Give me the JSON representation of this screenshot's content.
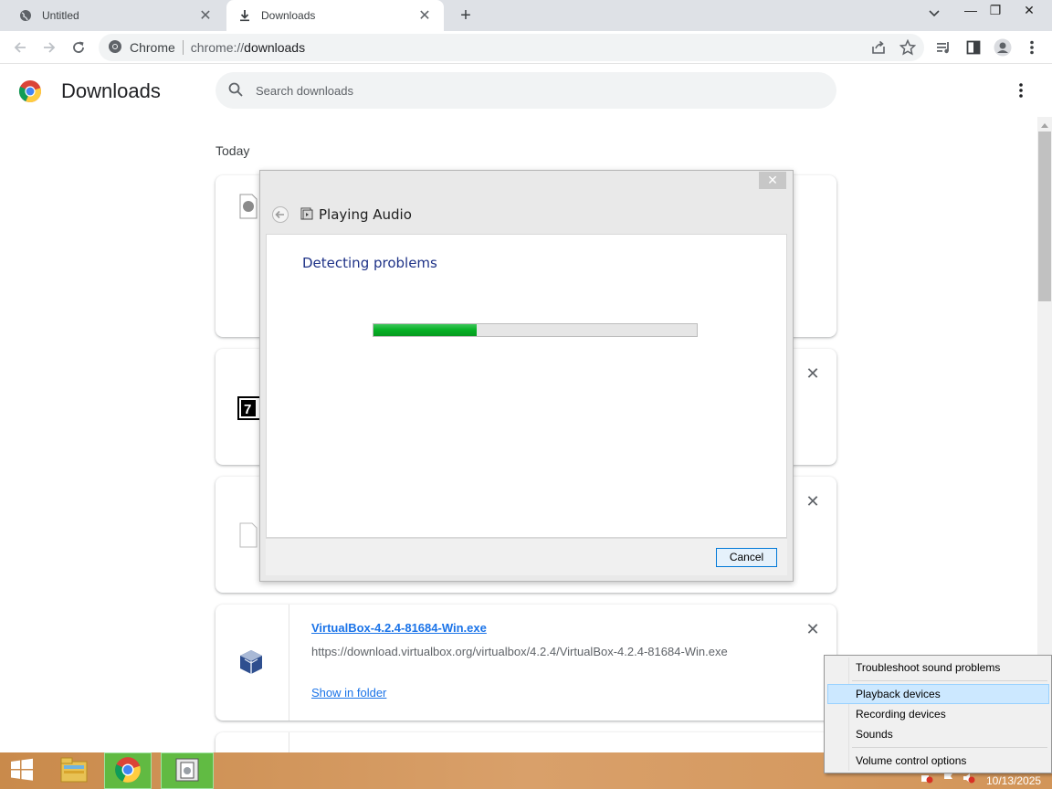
{
  "browser": {
    "tabs": [
      {
        "label": "Untitled",
        "active": false
      },
      {
        "label": "Downloads",
        "active": true
      }
    ],
    "window_controls": {
      "minimize": "—",
      "restore": "❐",
      "close": "✕"
    },
    "omnibox": {
      "site_label": "Chrome",
      "url_prefix": "chrome://",
      "url_path": "downloads"
    }
  },
  "downloads_page": {
    "title": "Downloads",
    "search_placeholder": "Search downloads",
    "section_label": "Today",
    "items": [
      {
        "filename": "VirtualBox-4.2.4-81684-Win.exe",
        "url": "https://download.virtualbox.org/virtualbox/4.2.4/VirtualBox-4.2.4-81684-Win.exe",
        "show_in_folder": "Show in folder"
      }
    ]
  },
  "dialog": {
    "title": "Playing Audio",
    "heading": "Detecting problems",
    "progress": 0.32,
    "cancel_label": "Cancel",
    "close_glyph": "✕"
  },
  "context_menu": {
    "items": [
      {
        "label": "Troubleshoot sound problems",
        "highlighted": false
      },
      {
        "label": "Playback devices",
        "highlighted": true
      },
      {
        "label": "Recording devices",
        "highlighted": false
      },
      {
        "label": "Sounds",
        "highlighted": false
      },
      {
        "label": "Volume control options",
        "highlighted": false
      }
    ]
  },
  "taskbar": {
    "clock_date": "10/13/2025"
  },
  "colors": {
    "accent_link": "#1a73e8",
    "progress_green": "#06b025",
    "menu_highlight": "#cce8ff"
  }
}
